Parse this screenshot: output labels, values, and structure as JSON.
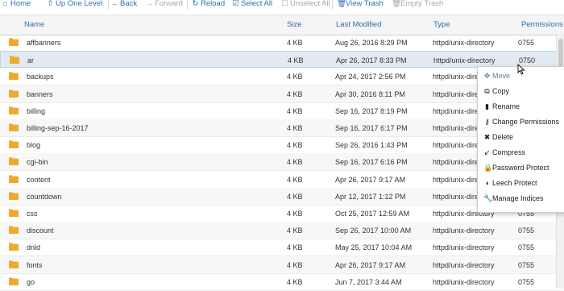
{
  "toolbar": {
    "home": "Home",
    "up_one_level": "Up One Level",
    "back": "Back",
    "forward": "Forward",
    "reload": "Reload",
    "select_all": "Select All",
    "unselect_all": "Unselect All",
    "view_trash": "View Trash",
    "empty_trash": "Empty Trash"
  },
  "table": {
    "headers": {
      "name": "Name",
      "size": "Size",
      "modified": "Last Modified",
      "type": "Type",
      "permissions": "Permissions"
    },
    "rows": [
      {
        "name": "affbanners",
        "size": "4 KB",
        "modified": "Aug 26, 2016 8:29 PM",
        "type": "httpd/unix-directory",
        "perm": "0755"
      },
      {
        "name": "ar",
        "size": "4 KB",
        "modified": "Apr 26, 2017 8:33 PM",
        "type": "httpd/unix-directory",
        "perm": "0750"
      },
      {
        "name": "backups",
        "size": "4 KB",
        "modified": "Apr 24, 2017 2:56 PM",
        "type": "httpd/unix-directory",
        "perm": ""
      },
      {
        "name": "banners",
        "size": "4 KB",
        "modified": "Apr 30, 2016 8:11 PM",
        "type": "httpd/unix-directory",
        "perm": ""
      },
      {
        "name": "billing",
        "size": "4 KB",
        "modified": "Sep 16, 2017 8:19 PM",
        "type": "httpd/unix-directory",
        "perm": ""
      },
      {
        "name": "billing-sep-16-2017",
        "size": "4 KB",
        "modified": "Sep 16, 2017 6:17 PM",
        "type": "httpd/unix-directory",
        "perm": ""
      },
      {
        "name": "blog",
        "size": "4 KB",
        "modified": "Sep 26, 2016 1:43 PM",
        "type": "httpd/unix-directory",
        "perm": ""
      },
      {
        "name": "cgi-bin",
        "size": "4 KB",
        "modified": "Sep 16, 2017 6:16 PM",
        "type": "httpd/unix-directory",
        "perm": ""
      },
      {
        "name": "content",
        "size": "4 KB",
        "modified": "Apr 26, 2017 9:17 AM",
        "type": "httpd/unix-directory",
        "perm": ""
      },
      {
        "name": "countdown",
        "size": "4 KB",
        "modified": "Apr 12, 2017 1:12 PM",
        "type": "httpd/unix-directory",
        "perm": ""
      },
      {
        "name": "css",
        "size": "4 KB",
        "modified": "Oct 25, 2017 12:59 AM",
        "type": "httpd/unix-directory",
        "perm": "0755"
      },
      {
        "name": "discount",
        "size": "4 KB",
        "modified": "Sep 26, 2017 10:00 AM",
        "type": "httpd/unix-directory",
        "perm": "0755"
      },
      {
        "name": "dnld",
        "size": "4 KB",
        "modified": "May 25, 2017 10:04 AM",
        "type": "httpd/unix-directory",
        "perm": "0755"
      },
      {
        "name": "fonts",
        "size": "4 KB",
        "modified": "Apr 26, 2017 9:17 AM",
        "type": "httpd/unix-directory",
        "perm": "0755"
      },
      {
        "name": "go",
        "size": "4 KB",
        "modified": "Jun 7, 2017 3:44 AM",
        "type": "httpd/unix-directory",
        "perm": "0755"
      }
    ]
  },
  "context_menu": {
    "items": [
      {
        "label": "Move",
        "icon": "move-icon"
      },
      {
        "label": "Copy",
        "icon": "copy-icon"
      },
      {
        "label": "Rename",
        "icon": "rename-icon"
      },
      {
        "label": "Change Permissions",
        "icon": "key-icon"
      },
      {
        "label": "Delete",
        "icon": "delete-icon"
      },
      {
        "label": "Compress",
        "icon": "compress-icon"
      },
      {
        "label": "Password Protect",
        "icon": "lock-icon"
      },
      {
        "label": "Leech Protect",
        "icon": "shield-icon"
      },
      {
        "label": "Manage Indices",
        "icon": "wrench-icon"
      }
    ]
  },
  "colors": {
    "accent": "#2d6fb0",
    "folder": "#f0a830",
    "selected_row": "#dfeaf3"
  }
}
